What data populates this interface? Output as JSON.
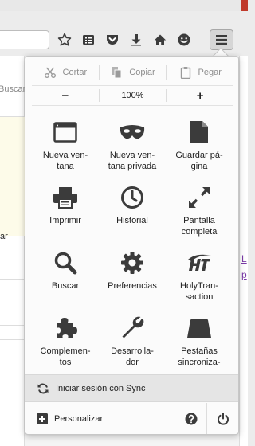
{
  "background": {
    "left_fragments": [
      "Buscar",
      "ar"
    ],
    "right_links": [
      "L",
      "p"
    ]
  },
  "toolbar": {
    "icons": [
      "bookmark-star-icon",
      "reading-list-icon",
      "pocket-icon",
      "download-icon",
      "home-icon",
      "hello-chat-icon"
    ],
    "menu_icon": "hamburger-menu-icon"
  },
  "menu": {
    "edit": {
      "cut": "Cortar",
      "copy": "Copiar",
      "paste": "Pegar"
    },
    "zoom": {
      "minus": "−",
      "value": "100%",
      "plus": "+"
    },
    "items": [
      {
        "label": "Nueva ven-\ntana",
        "icon": "new-window-icon"
      },
      {
        "label": "Nueva ven-\ntana privada",
        "icon": "private-mask-icon"
      },
      {
        "label": "Guardar pá-\ngina",
        "icon": "save-page-icon"
      },
      {
        "label": "Imprimir",
        "icon": "print-icon"
      },
      {
        "label": "Historial",
        "icon": "history-clock-icon"
      },
      {
        "label": "Pantalla\ncompleta",
        "icon": "fullscreen-icon"
      },
      {
        "label": "Buscar",
        "icon": "search-icon"
      },
      {
        "label": "Preferencias",
        "icon": "preferences-gear-icon"
      },
      {
        "label": "HolyTran-\nsaction",
        "icon": "holytransaction-logo-icon"
      },
      {
        "label": "Complemen-\ntos",
        "icon": "addons-puzzle-icon"
      },
      {
        "label": "Desarrolla-\ndor",
        "icon": "developer-wrench-icon"
      },
      {
        "label": "Pestañas\nsincroniza-",
        "icon": "synced-tabs-icon"
      }
    ],
    "sync_label": "Iniciar sesión con Sync",
    "customize_label": "Personalizar"
  },
  "colors": {
    "icon": "#3b3b3b",
    "disabled": "#9a9a9a",
    "link": "#7a3aa8"
  }
}
